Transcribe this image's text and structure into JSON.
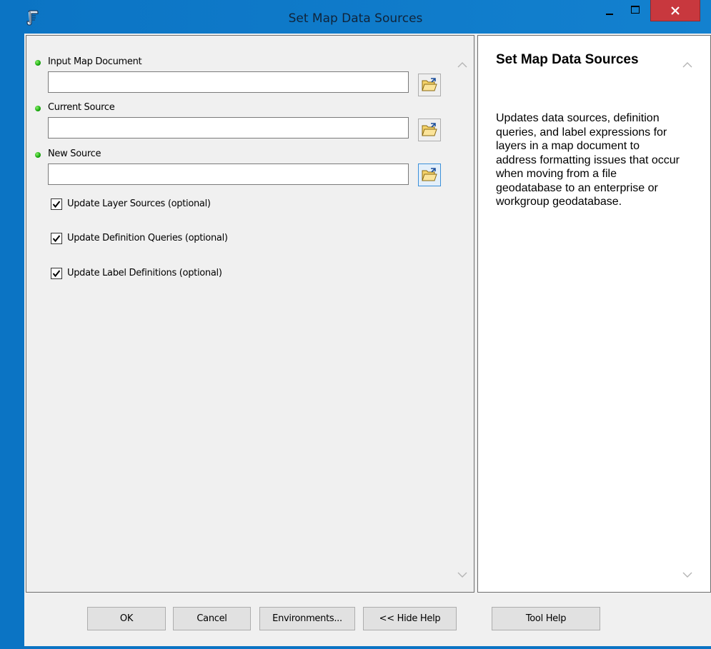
{
  "window": {
    "title": "Set Map Data Sources"
  },
  "params": [
    {
      "label": "Input Map Document",
      "value": ""
    },
    {
      "label": "Current Source",
      "value": ""
    },
    {
      "label": "New Source",
      "value": ""
    }
  ],
  "options": [
    {
      "label": "Update Layer Sources (optional)",
      "checked": true
    },
    {
      "label": "Update Definition Queries (optional)",
      "checked": true
    },
    {
      "label": "Update Label Definitions (optional)",
      "checked": true
    }
  ],
  "help": {
    "title": "Set Map Data Sources",
    "body": "Updates data sources, definition queries, and label expressions for layers in a map document to address formatting issues that occur when moving from a file geodatabase to an enterprise or workgroup geodatabase."
  },
  "buttons": {
    "ok": "OK",
    "cancel": "Cancel",
    "environments": "Environments...",
    "hide_help": "<< Hide Help",
    "tool_help": "Tool Help"
  },
  "icons": {
    "app": "script-tool-icon",
    "browse": "open-folder-icon",
    "required": "green-dot-icon",
    "accent_close": "#c8383e"
  }
}
